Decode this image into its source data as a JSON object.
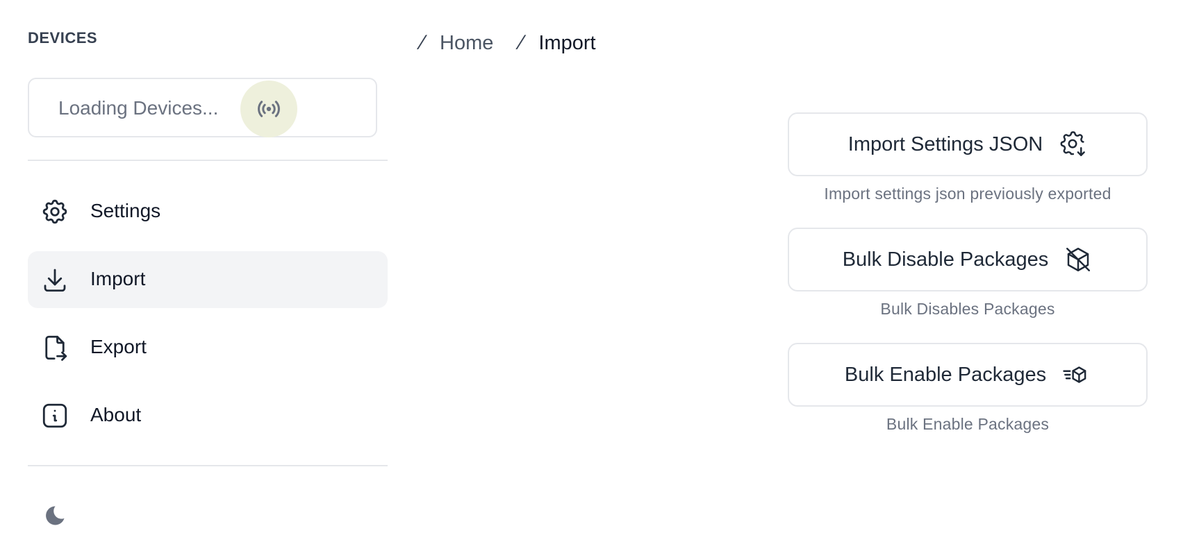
{
  "sidebar": {
    "heading": "DEVICES",
    "device_selector": {
      "label": "Loading Devices...",
      "icon": "radio-signal-icon"
    },
    "items": [
      {
        "label": "Settings",
        "icon": "gear-icon",
        "active": false
      },
      {
        "label": "Import",
        "icon": "download-icon",
        "active": true
      },
      {
        "label": "Export",
        "icon": "file-export-icon",
        "active": false
      },
      {
        "label": "About",
        "icon": "info-icon",
        "active": false
      }
    ],
    "theme_toggle_icon": "moon-icon"
  },
  "breadcrumb": {
    "home": "Home",
    "current": "Import"
  },
  "actions": [
    {
      "label": "Import Settings JSON",
      "description": "Import settings json previously exported",
      "icon": "gear-download-icon"
    },
    {
      "label": "Bulk Disable Packages",
      "description": "Bulk Disables Packages",
      "icon": "package-off-icon"
    },
    {
      "label": "Bulk Enable Packages",
      "description": "Bulk Enable Packages",
      "icon": "package-fast-icon"
    }
  ],
  "colors": {
    "active_nav_bg": "#f3f4f6",
    "border": "#e5e7eb",
    "muted_text": "#6b7280",
    "device_badge_bg": "#eef0dc"
  }
}
